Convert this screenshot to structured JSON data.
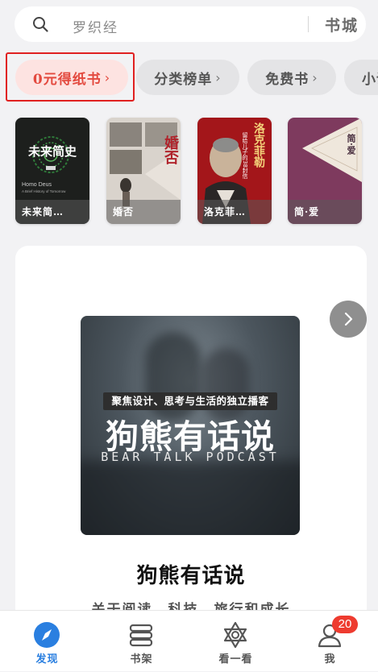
{
  "search": {
    "placeholder": "罗织经",
    "store_label": "书城"
  },
  "chips": [
    {
      "label": "0元得纸书",
      "active": true
    },
    {
      "label": "分类榜单",
      "active": false
    },
    {
      "label": "免费书",
      "active": false
    },
    {
      "label": "小说",
      "active": false
    }
  ],
  "chip_chevron": "›",
  "books": [
    {
      "title": "未来简…",
      "cover_title": "未来简史",
      "cover_subtitle": "Homo Deus",
      "cover_subtitle2": "A Brief History of Tomorrow"
    },
    {
      "title": "婚否",
      "cover_title": "婚否"
    },
    {
      "title": "洛克菲…",
      "cover_title": "洛克菲勒",
      "cover_subtitle": "留给儿子的38封信"
    },
    {
      "title": "简·爱",
      "cover_title": "简·爱"
    }
  ],
  "podcast": {
    "cover_tagline": "聚焦设计、思考与生活的独立播客",
    "cover_title": "狗熊有话说",
    "cover_subtitle": "BEAR TALK PODCAST",
    "title": "狗熊有话说",
    "description": "关于阅读、科技、旅行和成长"
  },
  "tabs": [
    {
      "label": "发现",
      "icon": "compass-icon",
      "active": true
    },
    {
      "label": "书架",
      "icon": "bookshelf-icon",
      "active": false
    },
    {
      "label": "看一看",
      "icon": "star-of-david-icon",
      "active": false
    },
    {
      "label": "我",
      "icon": "profile-icon",
      "active": false
    }
  ],
  "notification_badge": "20",
  "colors": {
    "accent": "#2a7fe0",
    "chip_active": "#e34a3f",
    "badge": "#ee3b2f"
  }
}
